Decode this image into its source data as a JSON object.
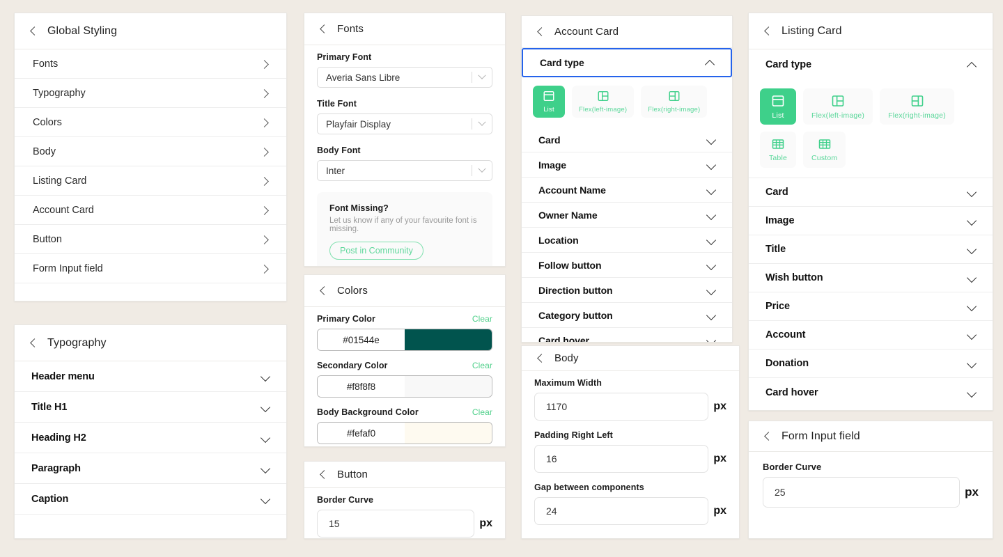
{
  "theme": {
    "page_background": "#f0ebe4",
    "accent_green": "#3ed08a",
    "accent_green_text": "#5ad79a",
    "focus_blue": "#2563eb",
    "panel_background": "#ffffff"
  },
  "global_styling": {
    "title": "Global Styling",
    "items": [
      {
        "label": "Fonts"
      },
      {
        "label": "Typography"
      },
      {
        "label": "Colors"
      },
      {
        "label": "Body"
      },
      {
        "label": "Listing Card"
      },
      {
        "label": "Account Card"
      },
      {
        "label": "Button"
      },
      {
        "label": "Form Input field"
      }
    ]
  },
  "typography": {
    "title": "Typography",
    "items": [
      {
        "label": "Header menu"
      },
      {
        "label": "Title H1"
      },
      {
        "label": "Heading H2"
      },
      {
        "label": "Paragraph"
      },
      {
        "label": "Caption"
      }
    ]
  },
  "fonts": {
    "title": "Fonts",
    "fields": [
      {
        "label": "Primary Font",
        "value": "Averia Sans Libre"
      },
      {
        "label": "Title Font",
        "value": "Playfair Display"
      },
      {
        "label": "Body Font",
        "value": "Inter"
      }
    ],
    "font_missing": {
      "title": "Font Missing?",
      "subtitle": "Let us know if any of your favourite font is missing.",
      "button": "Post in Community"
    }
  },
  "colors": {
    "title": "Colors",
    "clear_label": "Clear",
    "items": [
      {
        "label": "Primary Color",
        "value": "#01544e",
        "swatch": "#01544e"
      },
      {
        "label": "Secondary Color",
        "value": "#f8f8f8",
        "swatch": "#f8f8f8"
      },
      {
        "label": "Body Background Color",
        "value": "#fefaf0",
        "swatch": "#fefaf0"
      }
    ]
  },
  "button_panel": {
    "title": "Button",
    "field": {
      "label": "Border Curve",
      "value": "15",
      "unit": "px"
    }
  },
  "account_card": {
    "title": "Account Card",
    "card_type": {
      "label": "Card type",
      "expanded": true,
      "focused": true,
      "options": [
        {
          "label": "List",
          "icon": "layout-list-icon",
          "selected": true
        },
        {
          "label": "Flex(left-image)",
          "icon": "layout-left-image-icon",
          "selected": false
        },
        {
          "label": "Flex(right-image)",
          "icon": "layout-right-image-icon",
          "selected": false
        }
      ]
    },
    "sections": [
      {
        "label": "Card"
      },
      {
        "label": "Image"
      },
      {
        "label": "Account Name"
      },
      {
        "label": "Owner Name"
      },
      {
        "label": "Location"
      },
      {
        "label": "Follow button"
      },
      {
        "label": "Direction button"
      },
      {
        "label": "Category button"
      },
      {
        "label": "Card hover"
      }
    ]
  },
  "body_panel": {
    "title": "Body",
    "fields": [
      {
        "label": "Maximum Width",
        "value": "1170",
        "unit": "px"
      },
      {
        "label": "Padding Right Left",
        "value": "16",
        "unit": "px"
      },
      {
        "label": "Gap between components",
        "value": "24",
        "unit": "px"
      }
    ]
  },
  "listing_card": {
    "title": "Listing Card",
    "card_type": {
      "label": "Card type",
      "expanded": true,
      "options": [
        {
          "label": "List",
          "icon": "layout-list-icon",
          "selected": true
        },
        {
          "label": "Flex(left-image)",
          "icon": "layout-left-image-icon",
          "selected": false
        },
        {
          "label": "Flex(right-image)",
          "icon": "layout-right-image-icon",
          "selected": false
        },
        {
          "label": "Table",
          "icon": "table-icon",
          "selected": false
        },
        {
          "label": "Custom",
          "icon": "table-icon",
          "selected": false
        }
      ]
    },
    "sections": [
      {
        "label": "Card"
      },
      {
        "label": "Image"
      },
      {
        "label": "Title"
      },
      {
        "label": "Wish button"
      },
      {
        "label": "Price"
      },
      {
        "label": "Account"
      },
      {
        "label": "Donation"
      },
      {
        "label": "Card hover"
      }
    ]
  },
  "form_input_field": {
    "title": "Form Input field",
    "field": {
      "label": "Border Curve",
      "value": "25",
      "unit": "px"
    }
  }
}
